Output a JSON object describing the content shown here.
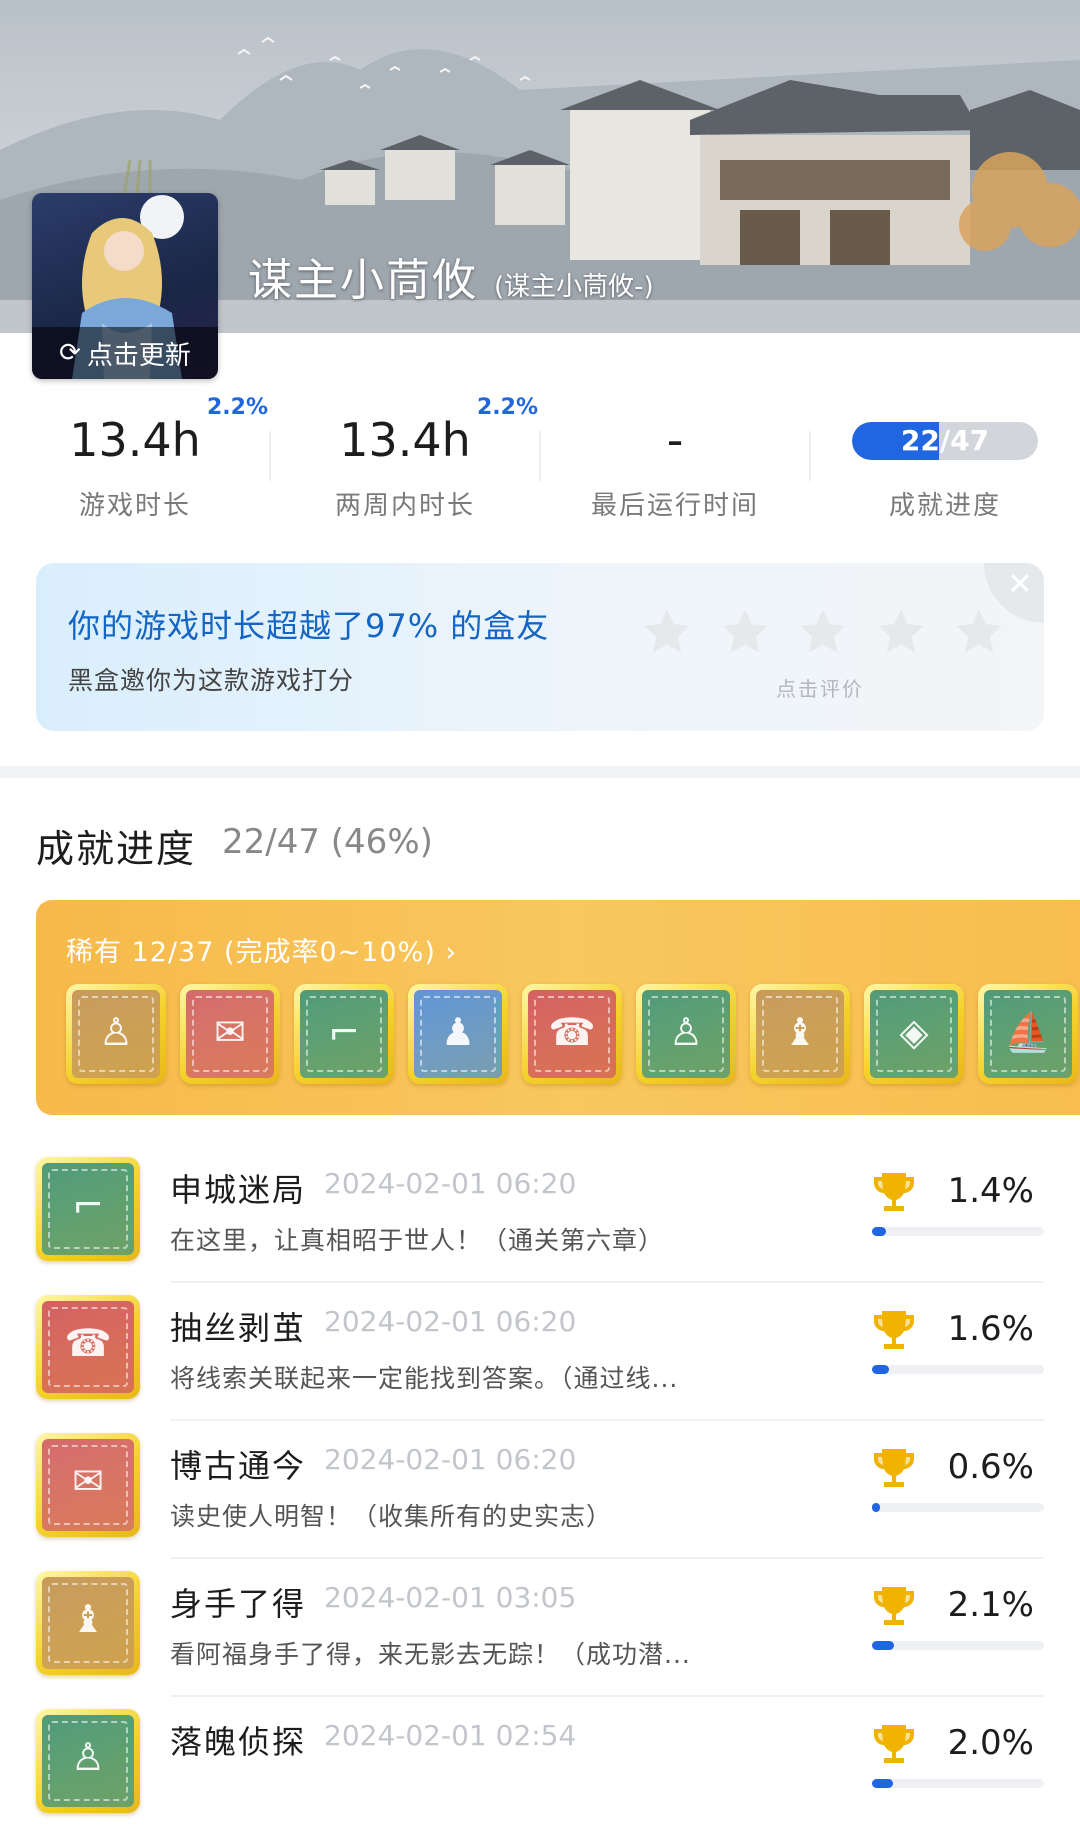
{
  "profile": {
    "avatar_update_label": "点击更新",
    "name": "谋主小茼攸",
    "alias": "(谋主小茼攸-)"
  },
  "stats": [
    {
      "value": "13.4h",
      "badge": "2.2%",
      "label": "游戏时长"
    },
    {
      "value": "13.4h",
      "badge": "2.2%",
      "label": "两周内时长"
    },
    {
      "value": "-",
      "badge": "",
      "label": "最后运行时间"
    },
    {
      "value": "22/47",
      "progress": 0.468,
      "label": "成就进度"
    }
  ],
  "rating_card": {
    "title": "你的游戏时长超越了97% 的盒友",
    "subtitle": "黑盒邀你为这款游戏打分",
    "hint": "点击评价",
    "stars_total": 5,
    "close_icon": "close-icon"
  },
  "achievements": {
    "title": "成就进度",
    "count": "22/47 (46%)",
    "rare": {
      "header": "稀有 12/37 (完成率0~10%) ›",
      "badges": [
        {
          "color": "#c79a5a",
          "glyph": "♙"
        },
        {
          "color": "#d46a6a",
          "glyph": "✉"
        },
        {
          "color": "#4f9a78",
          "glyph": "⌐"
        },
        {
          "color": "#5f95d4",
          "glyph": "♟"
        },
        {
          "color": "#d46060",
          "glyph": "☎"
        },
        {
          "color": "#4f9a78",
          "glyph": "♙"
        },
        {
          "color": "#c79a5a",
          "glyph": "♝"
        },
        {
          "color": "#4f9a78",
          "glyph": "◈"
        },
        {
          "color": "#4f9a78",
          "glyph": "⛵"
        }
      ]
    },
    "items": [
      {
        "name": "申城迷局",
        "date": "2024-02-01 06:20",
        "desc": "在这里，让真相昭于世人！（通关第六章）",
        "rate": "1.4%",
        "rate_value": 1.4,
        "color": "#4f9a78",
        "glyph": "⌐"
      },
      {
        "name": "抽丝剥茧",
        "date": "2024-02-01 06:20",
        "desc": "将线索关联起来一定能找到答案。（通过线...",
        "rate": "1.6%",
        "rate_value": 1.6,
        "color": "#d46060",
        "glyph": "☎"
      },
      {
        "name": "博古通今",
        "date": "2024-02-01 06:20",
        "desc": "读史使人明智！（收集所有的史实志）",
        "rate": "0.6%",
        "rate_value": 0.6,
        "color": "#d46a6a",
        "glyph": "✉"
      },
      {
        "name": "身手了得",
        "date": "2024-02-01 03:05",
        "desc": "看阿福身手了得，来无影去无踪！（成功潜...",
        "rate": "2.1%",
        "rate_value": 2.1,
        "color": "#c79a5a",
        "glyph": "♝"
      },
      {
        "name": "落魄侦探",
        "date": "2024-02-01 02:54",
        "desc": "",
        "rate": "2.0%",
        "rate_value": 2.0,
        "color": "#4f9a78",
        "glyph": "♙"
      }
    ]
  },
  "colors": {
    "accent": "#1f66e0",
    "rare": "#f7b94a",
    "trophy": "#f0b400"
  }
}
